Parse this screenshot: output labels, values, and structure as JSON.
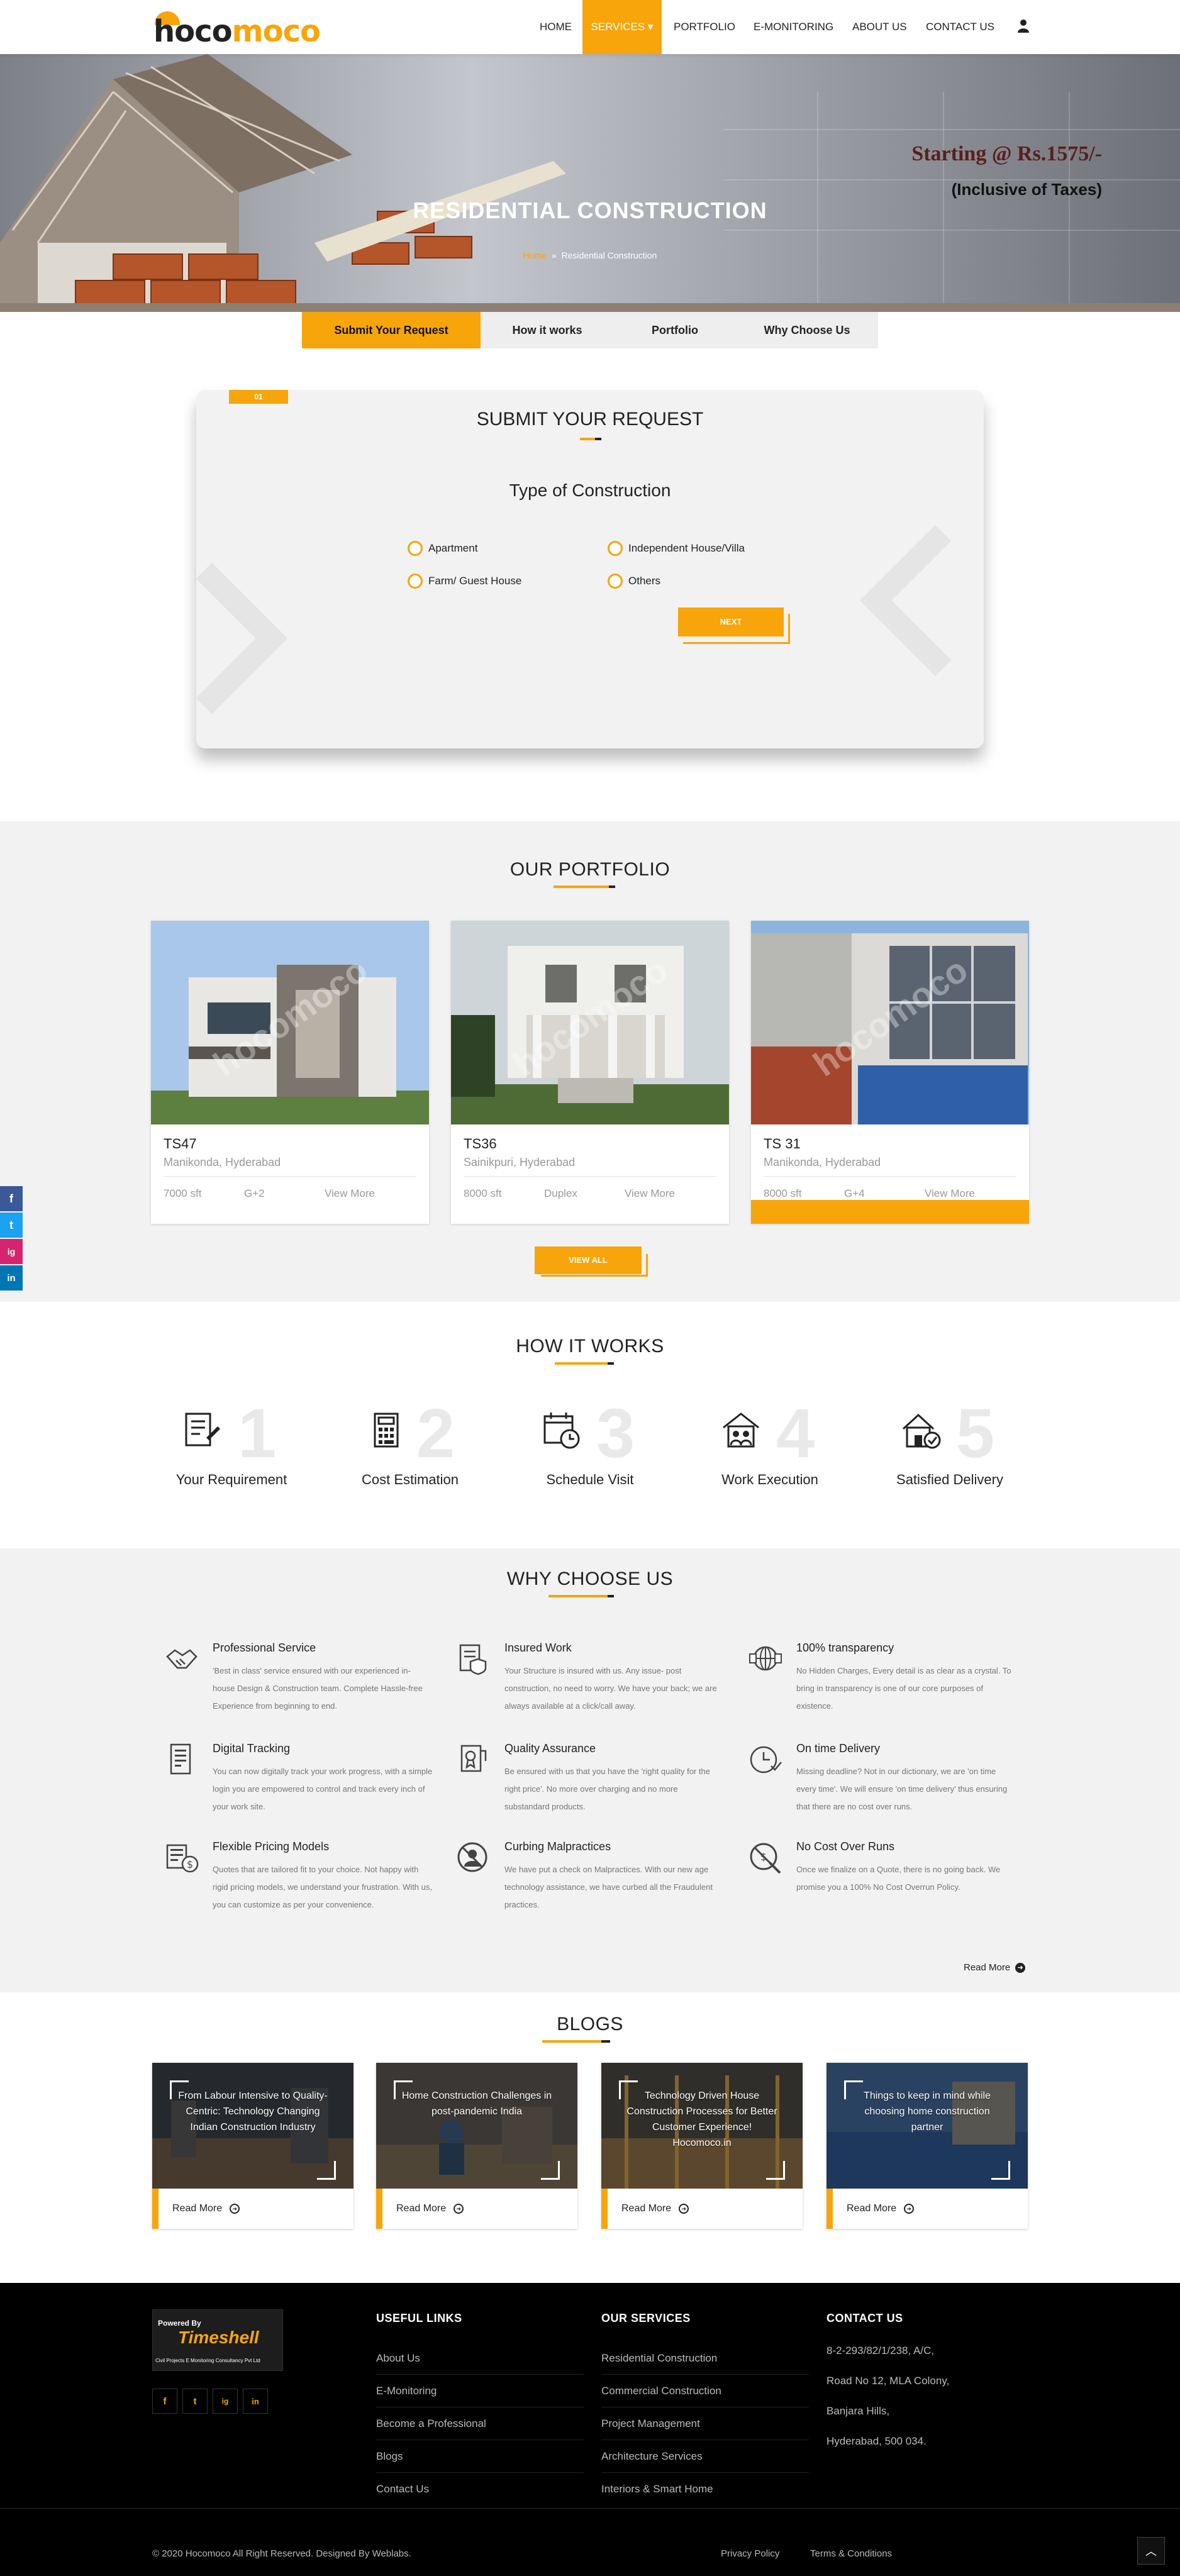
{
  "brand": {
    "logo_part1": "hoco",
    "logo_part2": "moco",
    "accent": "#f7a50b"
  },
  "nav": {
    "items": [
      "HOME",
      "SERVICES",
      "PORTFOLIO",
      "E-MONITORING",
      "ABOUT US",
      "CONTACT US"
    ],
    "active": "SERVICES"
  },
  "hero": {
    "title": "RESIDENTIAL CONSTRUCTION",
    "breadcrumb_home": "Home",
    "breadcrumb_sep": "»",
    "breadcrumb_current": "Residential Construction",
    "price": "Starting @ Rs.1575/-",
    "price_note": "(Inclusive of Taxes)"
  },
  "tabs": [
    "Submit Your Request",
    "How it works",
    "Portfolio",
    "Why Choose Us"
  ],
  "request": {
    "step": "01",
    "title": "SUBMIT YOUR REQUEST",
    "question": "Type of Construction",
    "options": [
      "Apartment",
      "Independent House/Villa",
      "Farm/ Guest House",
      "Others"
    ],
    "next_label": "NEXT"
  },
  "portfolio": {
    "title": "OUR PORTFOLIO",
    "watermark": "hocomoco",
    "items": [
      {
        "name": "TS47",
        "location": "Manikonda, Hyderabad",
        "area": "7000 sft",
        "floors": "G+2",
        "link": "View More"
      },
      {
        "name": "TS36",
        "location": "Sainikpuri, Hyderabad",
        "area": "8000 sft",
        "floors": "Duplex",
        "link": "View More"
      },
      {
        "name": "TS 31",
        "location": "Manikonda, Hyderabad",
        "area": "8000 sft",
        "floors": "G+4",
        "link": "View More"
      }
    ],
    "view_all": "VIEW ALL"
  },
  "social": {
    "facebook": "f",
    "twitter": "t",
    "instagram": "ig",
    "linkedin": "in"
  },
  "how": {
    "title": "HOW IT WORKS",
    "steps": [
      {
        "num": "1",
        "label": "Your Requirement"
      },
      {
        "num": "2",
        "label": "Cost Estimation"
      },
      {
        "num": "3",
        "label": "Schedule Visit"
      },
      {
        "num": "4",
        "label": "Work Execution"
      },
      {
        "num": "5",
        "label": "Satisfied Delivery"
      }
    ]
  },
  "why": {
    "title": "WHY CHOOSE US",
    "items": [
      {
        "title": "Professional Service",
        "desc": "'Best in class' service ensured with our experienced in-house Design & Construction team. Complete Hassle-free Experience from beginning to end."
      },
      {
        "title": "Insured Work",
        "desc": "Your Structure is insured with us. Any issue- post construction, no need to worry. We have your back; we are always available at a click/call away."
      },
      {
        "title": "100% transparency",
        "desc": "No Hidden Charges, Every detail is as clear as a crystal. To bring in transparency is one of our core purposes of existence."
      },
      {
        "title": "Digital Tracking",
        "desc": "You can now digitally track your work progress, with a simple login you are empowered to control and track every inch of your work site."
      },
      {
        "title": "Quality Assurance",
        "desc": "Be ensured with us that you have the 'right quality for the right price'. No more over charging and no more substandard products."
      },
      {
        "title": "On time Delivery",
        "desc": "Missing deadline? Not in our dictionary, we are 'on time every time'. We will ensure 'on time delivery' thus ensuring that there are no cost over runs."
      },
      {
        "title": "Flexible Pricing Models",
        "desc": "Quotes that are tailored fit to your choice. Not happy with rigid pricing models, we understand your frustration. With us, you can customize as per your convenience."
      },
      {
        "title": "Curbing Malpractices",
        "desc": "We have put a check on Malpractices. With our new age technology assistance, we have curbed all the Fraudulent practices."
      },
      {
        "title": "No Cost Over Runs",
        "desc": "Once we finalize on a Quote, there is no going back. We promise you a 100% No Cost Overrun Policy."
      }
    ],
    "read_more": "Read More"
  },
  "blogs": {
    "title": "BLOGS",
    "items": [
      {
        "title": "From Labour Intensive to Quality-Centric: Technology Changing Indian Construction Industry",
        "link": "Read More"
      },
      {
        "title": "Home Construction Challenges in post-pandemic India",
        "link": "Read More"
      },
      {
        "title": "Technology Driven House Construction Processes for Better Customer Experience! Hocomoco.in",
        "link": "Read More"
      },
      {
        "title": "Things to keep in mind while choosing home construction partner",
        "link": "Read More"
      }
    ]
  },
  "footer": {
    "powered_by": "Powered By",
    "powered_brand": "Timeshell",
    "powered_sub": "Civil Projects E Monitoring Consultancy Pvt Ltd",
    "useful_links_title": "USEFUL LINKS",
    "useful_links": [
      "About Us",
      "E-Monitoring",
      "Become a Professional",
      "Blogs",
      "Contact Us"
    ],
    "services_title": "OUR SERVICES",
    "services": [
      "Residential Construction",
      "Commercial Construction",
      "Project Management",
      "Architecture Services",
      "Interiors & Smart Home"
    ],
    "contact_title": "CONTACT US",
    "address": [
      "8-2-293/82/1/238, A/C,",
      "Road No 12, MLA Colony,",
      "Banjara Hills,",
      "Hyderabad, 500 034."
    ],
    "copyright": "© 2020 Hocomoco All Right Reserved. Designed By Weblabs.",
    "privacy": "Privacy Policy",
    "terms": "Terms & Conditions"
  }
}
